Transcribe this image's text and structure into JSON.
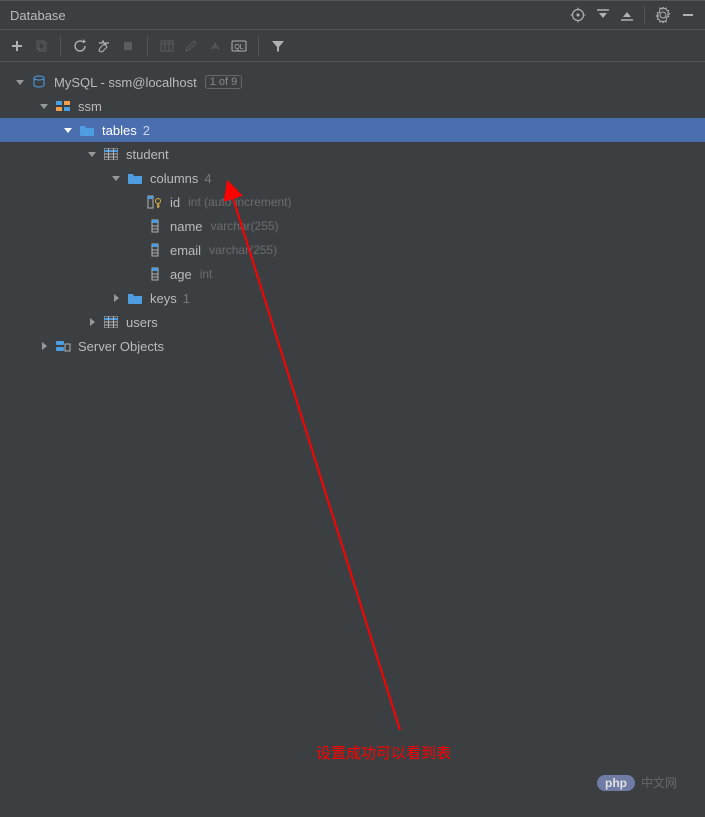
{
  "panel": {
    "title": "Database"
  },
  "connection": {
    "name": "MySQL - ssm@localhost",
    "badge": "1 of 9"
  },
  "schema": {
    "name": "ssm"
  },
  "tables_node": {
    "label": "tables",
    "count": "2"
  },
  "table_student": {
    "name": "student"
  },
  "columns_node": {
    "label": "columns",
    "count": "4"
  },
  "columns": {
    "id": {
      "name": "id",
      "type": "int (auto increment)"
    },
    "name": {
      "name": "name",
      "type": "varchar(255)"
    },
    "email": {
      "name": "email",
      "type": "varchar(255)"
    },
    "age": {
      "name": "age",
      "type": "int"
    }
  },
  "keys_node": {
    "label": "keys",
    "count": "1"
  },
  "table_users": {
    "name": "users"
  },
  "server_objects": {
    "label": "Server Objects"
  },
  "annotation": {
    "text": "设置成功可以看到表"
  },
  "watermark": {
    "brand": "php",
    "text": "中文网"
  }
}
